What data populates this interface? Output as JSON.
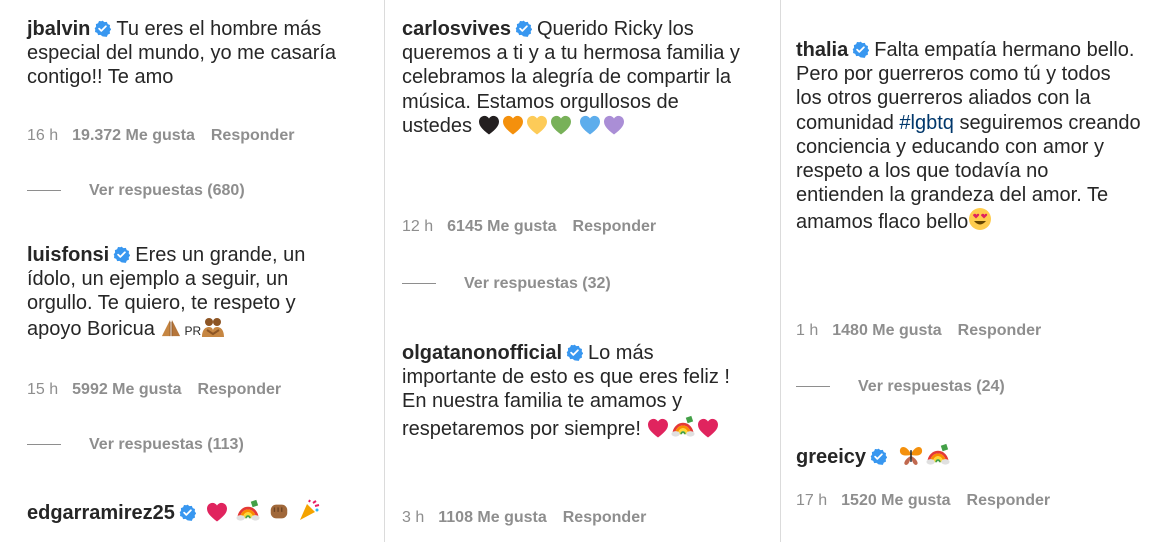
{
  "verified_color": "#3897f0",
  "link_color": "#00376b",
  "meta_color": "#8e8e8e",
  "comments": [
    {
      "user": "jbalvin",
      "text": "Tu eres el hombre más especial del mundo, yo me casaría contigo!! Te amo",
      "time": "16 h",
      "likes": "19.372 Me gusta",
      "reply": "Responder",
      "replies": "Ver respuestas (680)"
    },
    {
      "user": "luisfonsi",
      "text": "Eres un grande, un ídolo, un ejemplo a seguir, un orgullo. Te quiero, te respeto y apoyo Boricua",
      "emoji_text": "PR",
      "emojis": [
        "folded-hands-emoji",
        "people-hugging-emoji"
      ],
      "time": "15 h",
      "likes": "5992 Me gusta",
      "reply": "Responder",
      "replies": "Ver respuestas (113)"
    },
    {
      "user": "edgarramirez25",
      "emojis": [
        "red-heart-emoji",
        "rainbow-emoji",
        "fist-emoji",
        "party-popper-emoji"
      ]
    },
    {
      "user": "carlosvives",
      "text": "Querido Ricky los queremos a ti y a tu hermosa familia y celebramos la alegría de compartir la música. Estamos orgullosos de ustedes",
      "emojis": [
        "black-heart-emoji",
        "orange-heart-emoji",
        "yellow-heart-emoji",
        "green-heart-emoji",
        "blue-heart-emoji",
        "purple-heart-emoji"
      ],
      "time": "12 h",
      "likes": "6145 Me gusta",
      "reply": "Responder",
      "replies": "Ver respuestas (32)"
    },
    {
      "user": "olgatanonofficial",
      "text": "Lo más importante de esto es que eres feliz ! En nuestra familia te amamos y respetaremos por siempre!",
      "emojis": [
        "red-heart-emoji",
        "rainbow-emoji",
        "red-heart-emoji"
      ],
      "time": "3 h",
      "likes": "1108 Me gusta",
      "reply": "Responder"
    },
    {
      "user": "thalia",
      "text": "Falta empatía hermano bello. Pero por guerreros como tú y todos los otros guerreros aliados con la comunidad",
      "hashtag": "#lgbtq",
      "text2": "seguiremos creando conciencia y educando con amor y respeto a los que todavía no entienden la grandeza del amor. Te amamos flaco bello",
      "emojis": [
        "heart-eyes-emoji"
      ],
      "time": "1 h",
      "likes": "1480 Me gusta",
      "reply": "Responder",
      "replies": "Ver respuestas (24)"
    },
    {
      "user": "greeicy",
      "emojis": [
        "butterfly-emoji",
        "rainbow-emoji"
      ],
      "time": "17 h",
      "likes": "1520 Me gusta",
      "reply": "Responder"
    }
  ]
}
